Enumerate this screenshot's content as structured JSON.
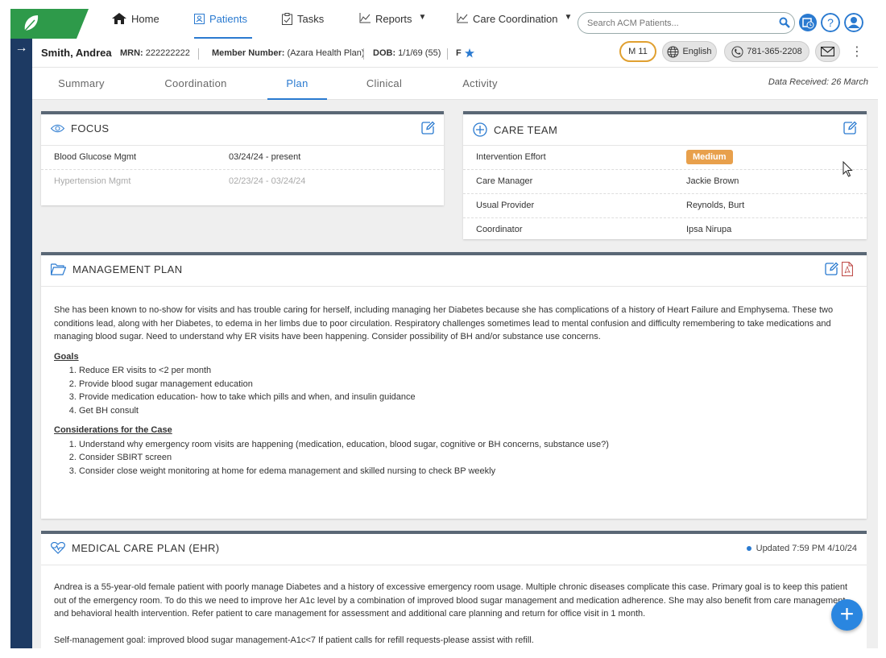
{
  "nav": {
    "items": [
      {
        "label": "Home",
        "icon": "home-icon"
      },
      {
        "label": "Patients",
        "icon": "patients-icon"
      },
      {
        "label": "Tasks",
        "icon": "tasks-icon"
      },
      {
        "label": "Reports",
        "icon": "reports-icon"
      },
      {
        "label": "Care Coordination",
        "icon": "care-coordination-icon"
      }
    ],
    "search_placeholder": "Search ACM Patients..."
  },
  "patient": {
    "name": "Smith, Andrea",
    "mrn_label": "MRN:",
    "mrn": "222222222",
    "member_label": "Member Number:",
    "member": "(Azara Health Plan)",
    "dob_label": "DOB:",
    "dob": "1/1/69 (55)",
    "sex": "F",
    "m_badge": "M 11",
    "language": "English",
    "phone": "781-365-2208"
  },
  "tabs": [
    "Summary",
    "Coordination",
    "Plan",
    "Clinical",
    "Activity"
  ],
  "active_tab": "Plan",
  "data_received": "Data Received: 26 March",
  "focus": {
    "title": "FOCUS",
    "rows": [
      {
        "name": "Blood Glucose Mgmt",
        "dates": "03/24/24 - present"
      },
      {
        "name": "Hypertension Mgmt",
        "dates": "02/23/24 - 03/24/24"
      }
    ]
  },
  "care_team": {
    "title": "CARE TEAM",
    "rows": [
      {
        "label": "Intervention Effort",
        "value": "Medium"
      },
      {
        "label": "Care Manager",
        "value": "Jackie Brown"
      },
      {
        "label": "Usual Provider",
        "value": "Reynolds, Burt"
      },
      {
        "label": "Coordinator",
        "value": "Ipsa Nirupa"
      }
    ]
  },
  "management_plan": {
    "title": "MANAGEMENT PLAN",
    "intro": "She has been known to no-show for visits and has trouble caring for herself, including managing her Diabetes because she has complications of a history of Heart Failure and Emphysema. These two conditions lead, along with her Diabetes, to edema in her limbs due to poor circulation. Respiratory challenges sometimes lead to mental confusion and difficulty remembering to take medications and managing blood sugar. Need to understand why ER visits have been happening. Consider possibility of BH and/or substance use concerns.",
    "goals_heading": "Goals",
    "goals": [
      "Reduce ER visits to <2 per month",
      "Provide blood sugar management education",
      "Provide medication education- how to take which pills and when, and insulin guidance",
      "Get BH consult"
    ],
    "considerations_heading": "Considerations for the Case",
    "considerations": [
      "Understand why emergency room visits are happening (medication, education, blood sugar, cognitive or BH concerns, substance use?)",
      "Consider SBIRT screen",
      "Consider close weight monitoring at home for edema management and skilled nursing to check BP weekly"
    ]
  },
  "medical_care_plan": {
    "title": "MEDICAL CARE PLAN (EHR)",
    "updated": "Updated 7:59 PM 4/10/24",
    "body": "Andrea is a 55-year-old female patient with poorly manage Diabetes and a history of excessive emergency room usage. Multiple chronic diseases complicate this case. Primary goal is to keep this patient out of the emergency room. To do this we need to improve her A1c level by a combination of improved blood sugar management and medication adherence. She may also benefit from care management and behavioral health intervention. Refer patient to care management for assessment and additional care planning and return for office visit in 1 month.",
    "self_mgmt": "Self-management goal: improved blood sugar management-A1c<7 If patient calls for refill requests-please assist with refill."
  },
  "colors": {
    "accent": "#2a7ad0",
    "rail": "#1d3a63",
    "brand": "#2e9a4a",
    "badge": "#e8a04c",
    "m_badge_border": "#e0a030"
  }
}
